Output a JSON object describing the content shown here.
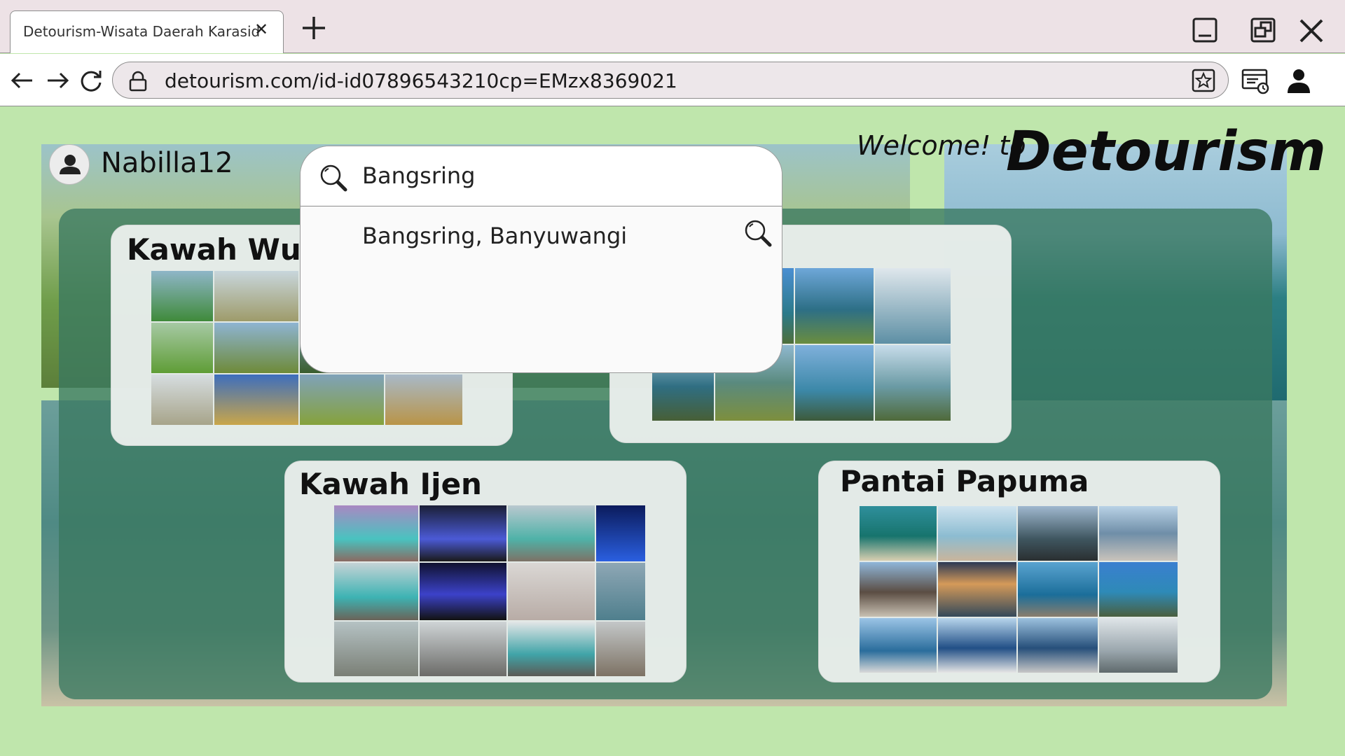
{
  "browser": {
    "tab_title": "Detourism-Wisata Daerah Karasid",
    "tab_close": "✕",
    "url": "detourism.com/id-id07896543210cp=EMzx8369021"
  },
  "header": {
    "username": "Nabilla12",
    "welcome": "Welcome! to",
    "brand": "Detourism"
  },
  "search": {
    "query": "Bangsring",
    "suggestions": [
      {
        "label": "Bangsring, Banyuwangi"
      }
    ]
  },
  "destinations": [
    {
      "title": "Kawah Wurung"
    },
    {
      "title": ""
    },
    {
      "title": "Kawah Ijen"
    },
    {
      "title": "Pantai Papuma"
    }
  ],
  "colors": {
    "page_bg": "#bfe6ac",
    "overlay": "#3a7860",
    "card_bg": "#ecf0ee"
  }
}
